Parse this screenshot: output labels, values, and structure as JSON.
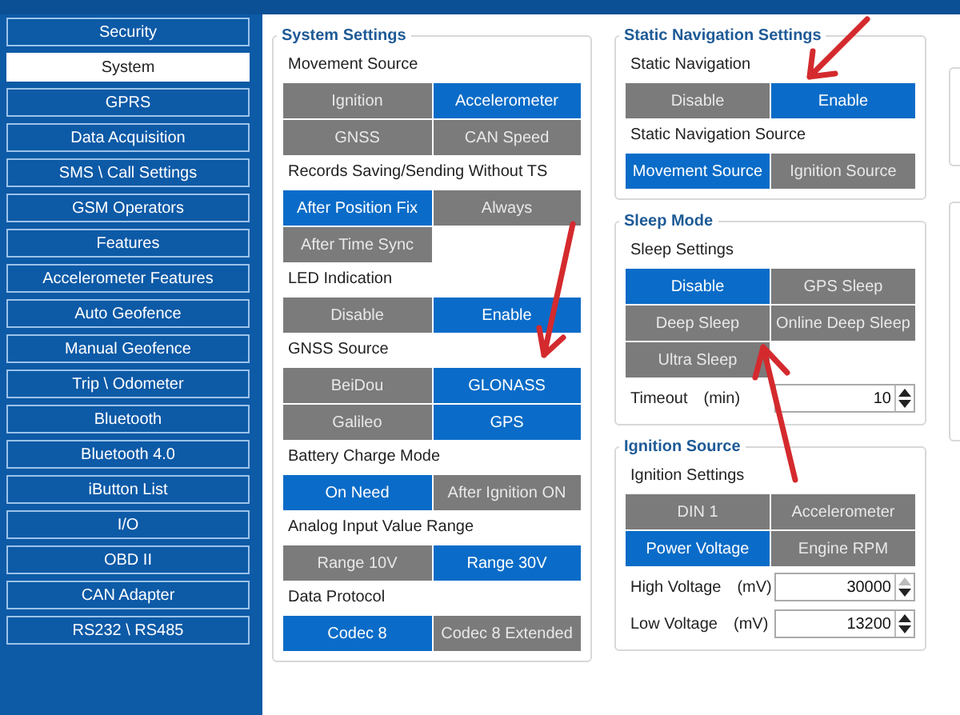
{
  "sidebar": {
    "items": [
      {
        "label": "Security",
        "selected": false
      },
      {
        "label": "System",
        "selected": true
      },
      {
        "label": "GPRS",
        "selected": false
      },
      {
        "label": "Data Acquisition",
        "selected": false
      },
      {
        "label": "SMS \\ Call Settings",
        "selected": false
      },
      {
        "label": "GSM Operators",
        "selected": false
      },
      {
        "label": "Features",
        "selected": false
      },
      {
        "label": "Accelerometer Features",
        "selected": false
      },
      {
        "label": "Auto Geofence",
        "selected": false
      },
      {
        "label": "Manual Geofence",
        "selected": false
      },
      {
        "label": "Trip \\ Odometer",
        "selected": false
      },
      {
        "label": "Bluetooth",
        "selected": false
      },
      {
        "label": "Bluetooth 4.0",
        "selected": false
      },
      {
        "label": "iButton List",
        "selected": false
      },
      {
        "label": "I/O",
        "selected": false
      },
      {
        "label": "OBD II",
        "selected": false
      },
      {
        "label": "CAN Adapter",
        "selected": false
      },
      {
        "label": "RS232 \\ RS485",
        "selected": false
      }
    ]
  },
  "columns": [
    {
      "panels": [
        {
          "title": "System Settings",
          "groups": [
            {
              "label": "Movement Source",
              "options": [
                {
                  "label": "Ignition",
                  "selected": false
                },
                {
                  "label": "Accelerometer",
                  "selected": true
                },
                {
                  "label": "GNSS",
                  "selected": false
                },
                {
                  "label": "CAN Speed",
                  "selected": false
                }
              ]
            },
            {
              "label": "Records Saving/Sending Without TS",
              "options": [
                {
                  "label": "After Position Fix",
                  "selected": true
                },
                {
                  "label": "Always",
                  "selected": false
                },
                {
                  "label": "After Time Sync",
                  "selected": false
                }
              ]
            },
            {
              "label": "LED Indication",
              "options": [
                {
                  "label": "Disable",
                  "selected": false
                },
                {
                  "label": "Enable",
                  "selected": true
                }
              ]
            },
            {
              "label": "GNSS Source",
              "options": [
                {
                  "label": "BeiDou",
                  "selected": false
                },
                {
                  "label": "GLONASS",
                  "selected": true
                },
                {
                  "label": "Galileo",
                  "selected": false
                },
                {
                  "label": "GPS",
                  "selected": true
                }
              ]
            },
            {
              "label": "Battery Charge Mode",
              "options": [
                {
                  "label": "On Need",
                  "selected": true
                },
                {
                  "label": "After Ignition ON",
                  "selected": false
                }
              ]
            },
            {
              "label": "Analog Input Value Range",
              "options": [
                {
                  "label": "Range 10V",
                  "selected": false
                },
                {
                  "label": "Range 30V",
                  "selected": true
                }
              ]
            },
            {
              "label": "Data Protocol",
              "options": [
                {
                  "label": "Codec 8",
                  "selected": true
                },
                {
                  "label": "Codec 8 Extended",
                  "selected": false
                }
              ]
            }
          ]
        }
      ]
    },
    {
      "panels": [
        {
          "title": "Static Navigation Settings",
          "groups": [
            {
              "label": "Static Navigation",
              "options": [
                {
                  "label": "Disable",
                  "selected": false
                },
                {
                  "label": "Enable",
                  "selected": true
                }
              ]
            },
            {
              "label": "Static Navigation Source",
              "options": [
                {
                  "label": "Movement Source",
                  "selected": true
                },
                {
                  "label": "Ignition Source",
                  "selected": false
                }
              ]
            }
          ]
        },
        {
          "title": "Sleep Mode",
          "groups": [
            {
              "label": "Sleep Settings",
              "options": [
                {
                  "label": "Disable",
                  "selected": true
                },
                {
                  "label": "GPS Sleep",
                  "selected": false
                },
                {
                  "label": "Deep Sleep",
                  "selected": false
                },
                {
                  "label": "Online Deep Sleep",
                  "selected": false
                },
                {
                  "label": "Ultra Sleep",
                  "selected": false
                }
              ]
            }
          ],
          "fields": [
            {
              "label": "Timeout",
              "unit": "(min)",
              "value": "10",
              "up_disabled": false
            }
          ]
        },
        {
          "title": "Ignition Source",
          "groups": [
            {
              "label": "Ignition Settings",
              "options": [
                {
                  "label": "DIN 1",
                  "selected": false
                },
                {
                  "label": "Accelerometer",
                  "selected": false
                },
                {
                  "label": "Power Voltage",
                  "selected": true
                },
                {
                  "label": "Engine RPM",
                  "selected": false
                }
              ]
            }
          ],
          "fields": [
            {
              "label": "High Voltage",
              "unit": "(mV)",
              "value": "30000",
              "up_disabled": true
            },
            {
              "label": "Low Voltage",
              "unit": "(mV)",
              "value": "13200",
              "up_disabled": false
            }
          ]
        }
      ]
    }
  ]
}
